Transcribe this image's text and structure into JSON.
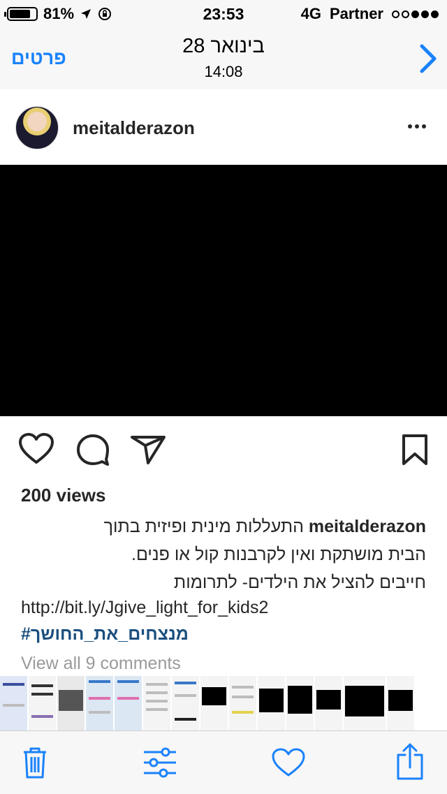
{
  "status_bar": {
    "battery": "81%",
    "battery_level": 0.81,
    "time": "23:53",
    "network": "4G",
    "carrier": "Partner",
    "signal_bars": 3,
    "signal_total": 5
  },
  "nav": {
    "details_label": "פרטים",
    "title": "28 בינואר",
    "subtitle": "14:08",
    "accent_color": "#1a82fb"
  },
  "post": {
    "username": "meitalderazon",
    "views": "200 views",
    "caption_username": "meitalderazon",
    "caption_line1": "התעללות מינית ופיזית בתוך",
    "caption_line2": "הבית מושתקת ואין לקרבנות קול או פנים.",
    "caption_line3": "חייבים להציל את הילדים- לתרומות",
    "caption_link": "http://bit.ly/Jgive_light_for_kids2",
    "hashtag": "#מנצחים_את_החושך",
    "comments": "View all 9 comments"
  },
  "icons": {
    "heart": "heart-icon",
    "comment": "comment-icon",
    "share": "send-icon",
    "bookmark": "bookmark-icon",
    "trash": "trash-icon",
    "adjust": "sliders-icon",
    "favorite": "heart-outline-icon",
    "export": "share-icon"
  }
}
